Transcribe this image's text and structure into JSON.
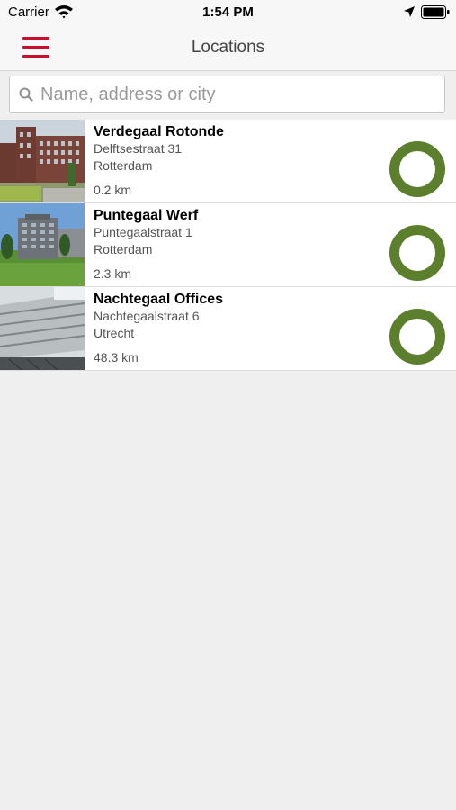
{
  "status_bar": {
    "carrier": "Carrier",
    "time": "1:54 PM"
  },
  "nav": {
    "title": "Locations",
    "menu_icon": "hamburger-menu-icon"
  },
  "search": {
    "placeholder": "Name, address or city",
    "value": ""
  },
  "colors": {
    "accent": "#c8102e",
    "status_ring": "#5b7f2c"
  },
  "locations": [
    {
      "name": "Verdegaal Rotonde",
      "street": "Delftsestraat 31",
      "city": "Rotterdam",
      "distance": "0.2 km"
    },
    {
      "name": "Puntegaal Werf",
      "street": "Puntegaalstraat 1",
      "city": "Rotterdam",
      "distance": "2.3 km"
    },
    {
      "name": "Nachtegaal Offices",
      "street": "Nachtegaalstraat 6",
      "city": "Utrecht",
      "distance": "48.3 km"
    }
  ]
}
